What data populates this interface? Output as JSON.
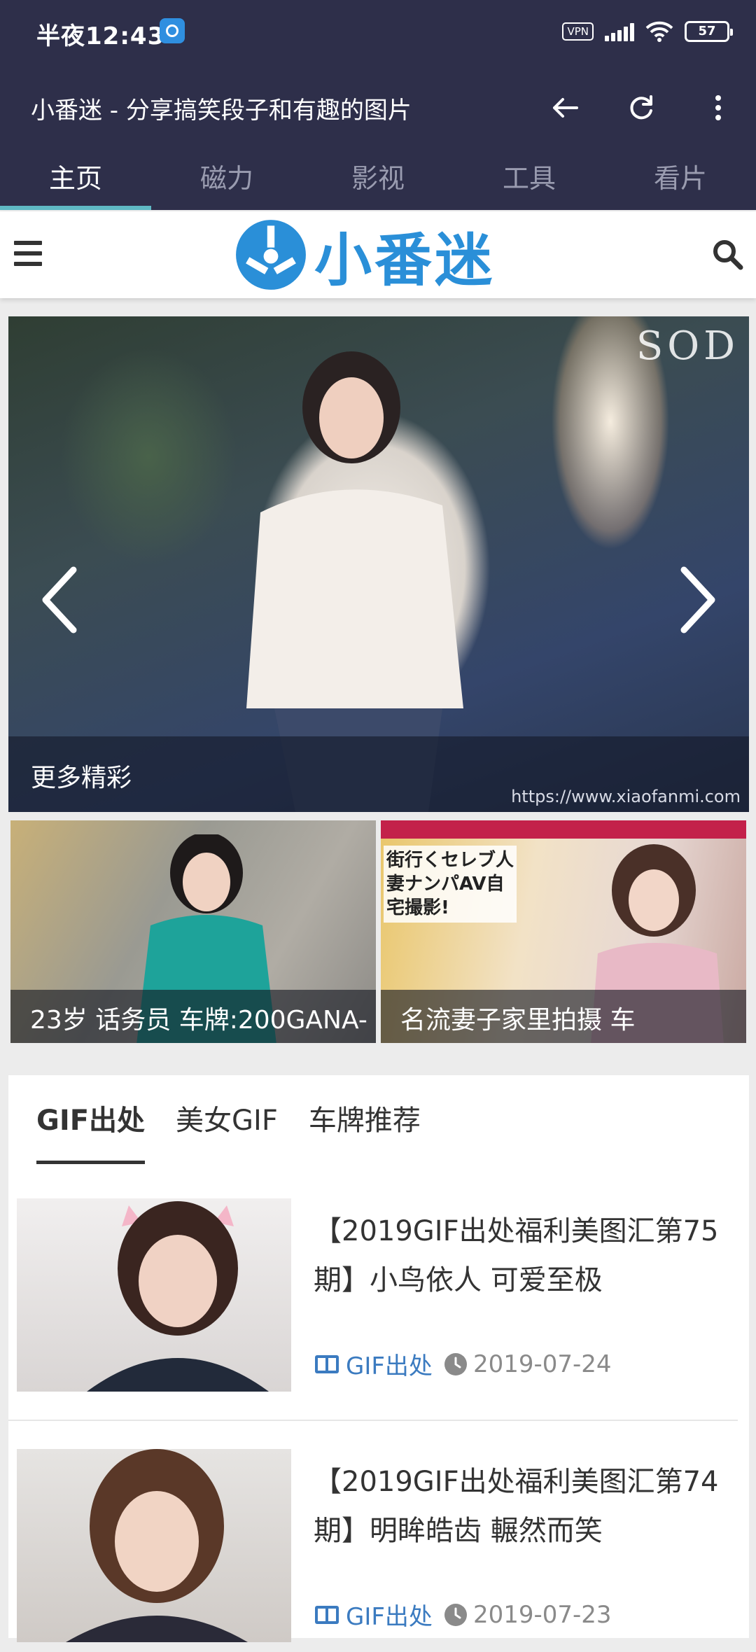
{
  "status_bar": {
    "time": "半夜12:43",
    "vpn": "VPN",
    "battery": "57"
  },
  "app_bar": {
    "title": "小番迷 - 分享搞笑段子和有趣的图片"
  },
  "tabs": [
    {
      "label": "主页",
      "active": true
    },
    {
      "label": "磁力",
      "active": false
    },
    {
      "label": "影视",
      "active": false
    },
    {
      "label": "工具",
      "active": false
    },
    {
      "label": "看片",
      "active": false
    }
  ],
  "site_header": {
    "logo_text": "小番迷"
  },
  "hero": {
    "caption": "更多精彩",
    "watermark": "https://www.xiaofanmi.com",
    "brand": "SOD"
  },
  "thumbnails": [
    {
      "caption": "23岁 话务员 车牌:200GANA-"
    },
    {
      "caption": "名流妻子家里拍摄 车",
      "overlay_text": "街行くセレブ人妻ナンパAV自宅撮影!"
    }
  ],
  "filter_tabs": [
    {
      "label": "GIF出处",
      "active": true
    },
    {
      "label": "美女GIF",
      "active": false
    },
    {
      "label": "车牌推荐",
      "active": false
    }
  ],
  "articles": [
    {
      "title": "【2019GIF出处福利美图汇第75期】小鸟依人 可爱至极",
      "category": "GIF出处",
      "date": "2019-07-24"
    },
    {
      "title": "【2019GIF出处福利美图汇第74期】明眸皓齿 輾然而笑",
      "category": "GIF出处",
      "date": "2019-07-23"
    }
  ],
  "colors": {
    "header_bg": "#2e2f4a",
    "tab_indicator": "#5fb9c4",
    "logo_blue": "#2a8fd8",
    "category_blue": "#3b7bc0"
  }
}
